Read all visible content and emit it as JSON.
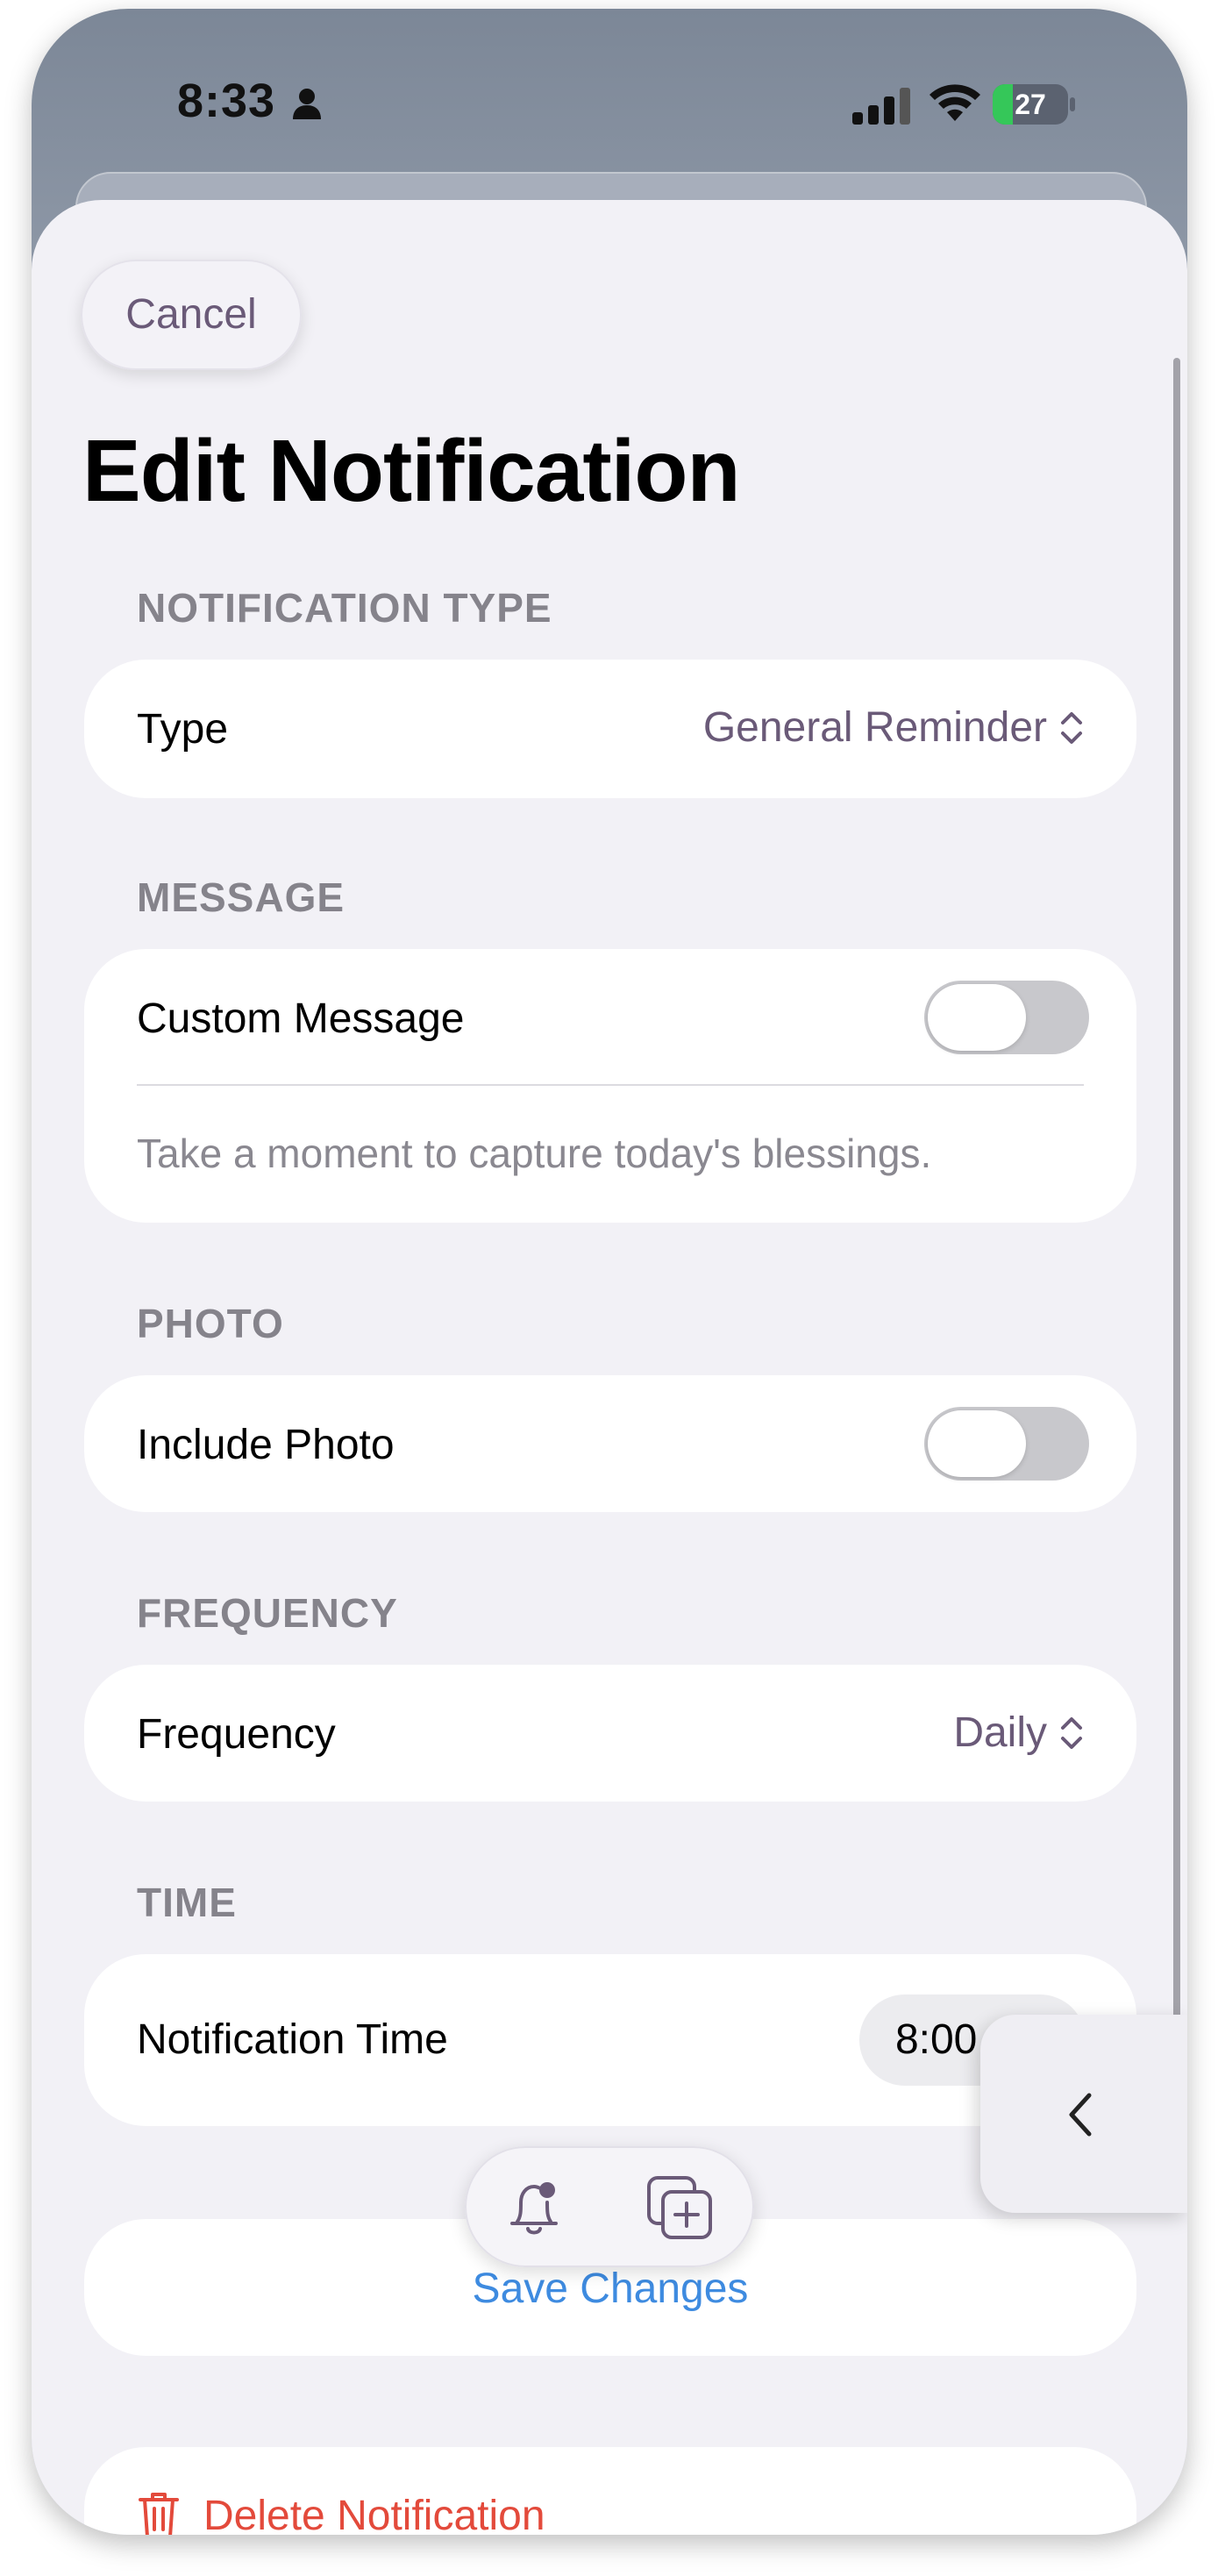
{
  "status_bar": {
    "time": "8:33",
    "battery_level": "27",
    "battery_fraction": 0.27
  },
  "header": {
    "cancel_label": "Cancel",
    "title": "Edit Notification"
  },
  "sections": {
    "type": {
      "heading": "NOTIFICATION TYPE",
      "label": "Type",
      "value": "General Reminder"
    },
    "message": {
      "heading": "MESSAGE",
      "label": "Custom Message",
      "toggle_on": false,
      "placeholder": "Take a moment to capture today's blessings."
    },
    "photo": {
      "heading": "PHOTO",
      "label": "Include Photo",
      "toggle_on": false
    },
    "frequency": {
      "heading": "FREQUENCY",
      "label": "Frequency",
      "value": "Daily"
    },
    "time": {
      "heading": "TIME",
      "label": "Notification Time",
      "value": "8:00 AM"
    }
  },
  "actions": {
    "save_label": "Save Changes",
    "delete_label": "Delete Notification"
  },
  "tabbar": {
    "icons": [
      "bell-badge-icon",
      "plus-square-icon"
    ]
  },
  "colors": {
    "accent": "#6a5a78",
    "link": "#3e8be0",
    "destructive": "#e34a3b",
    "background": "#f2f1f6"
  }
}
